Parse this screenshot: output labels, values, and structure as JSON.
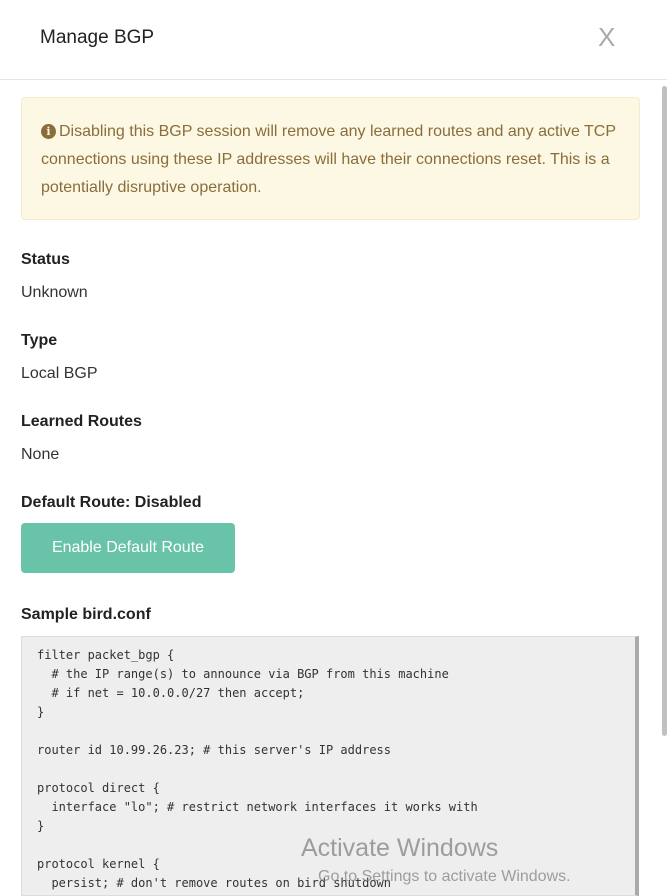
{
  "modal": {
    "title": "Manage BGP",
    "close_label": "X"
  },
  "alert": {
    "icon": "info-circle-icon",
    "text": "Disabling this BGP session will remove any learned routes and any active TCP connections using these IP addresses will have their connections reset. This is a potentially disruptive operation."
  },
  "fields": [
    {
      "label": "Status",
      "value": "Unknown"
    },
    {
      "label": "Type",
      "value": "Local BGP"
    },
    {
      "label": "Learned Routes",
      "value": "None"
    }
  ],
  "default_route": {
    "label": "Default Route: Disabled",
    "button": "Enable Default Route"
  },
  "sample": {
    "label": "Sample bird.conf",
    "code": "filter packet_bgp {\n  # the IP range(s) to announce via BGP from this machine\n  # if net = 10.0.0.0/27 then accept;\n}\n\nrouter id 10.99.26.23; # this server's IP address\n\nprotocol direct {\n  interface \"lo\"; # restrict network interfaces it works with\n}\n\nprotocol kernel {\n  persist; # don't remove routes on bird shutdown"
  },
  "watermark": {
    "line1": "Activate Windows",
    "line2": "Go to Settings to activate Windows."
  }
}
